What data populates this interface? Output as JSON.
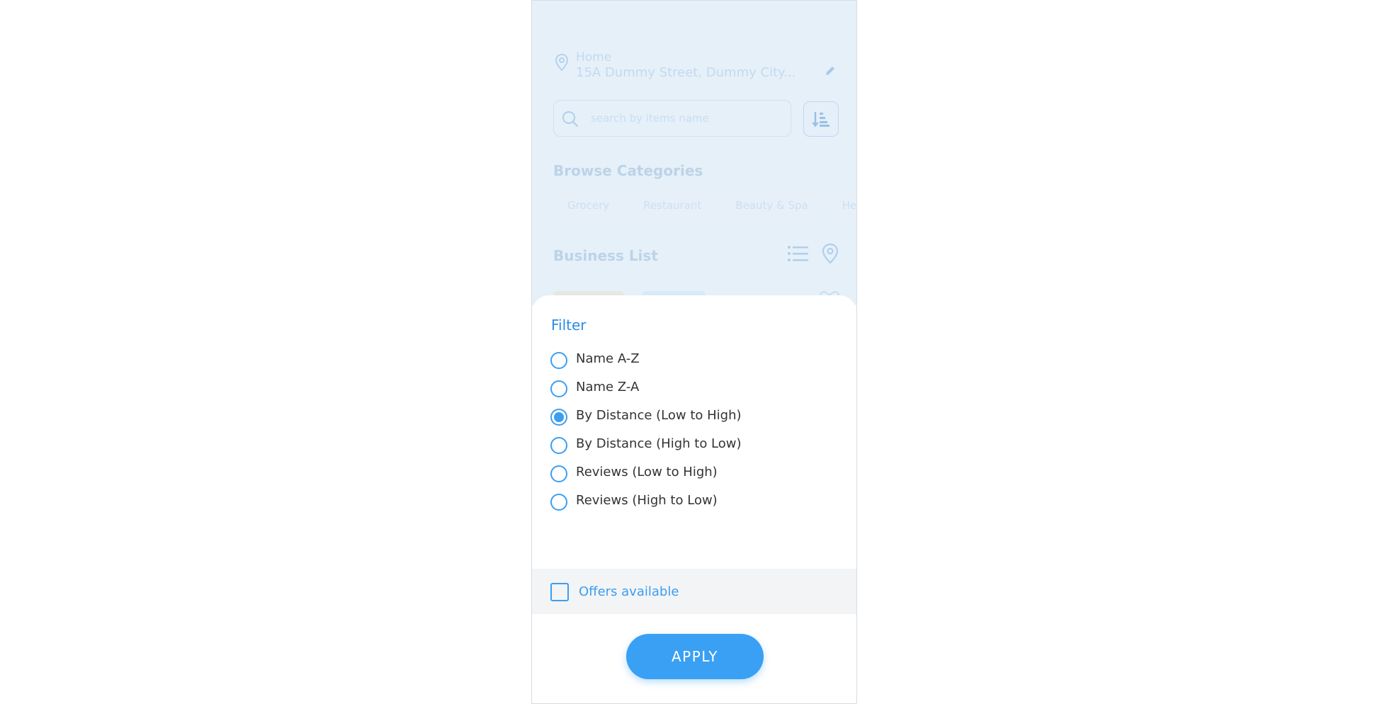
{
  "colors": {
    "accent": "#3b9ef0",
    "button": "#39a0f4",
    "backdrop": "#e6f0f9",
    "offers_row": "#f3f4f5"
  },
  "location": {
    "label": "Home",
    "address": "15A Dummy Street, Dummy City...",
    "pin_icon": "location-pin-icon",
    "edit_icon": "pencil-icon"
  },
  "search": {
    "placeholder": "search by items name",
    "value": "",
    "icon": "search-icon",
    "sort_icon": "sort-icon"
  },
  "categories": {
    "title": "Browse Categories",
    "items": [
      "Grocery",
      "Restaurant",
      "Beauty & Spa",
      "Heal"
    ]
  },
  "business_list": {
    "title": "Business List",
    "list_icon": "list-view-icon",
    "map_icon": "map-pin-icon"
  },
  "filter": {
    "title": "Filter",
    "options": [
      {
        "label": "Name A-Z",
        "checked": false
      },
      {
        "label": "Name Z-A",
        "checked": false
      },
      {
        "label": "By Distance (Low to High)",
        "checked": true
      },
      {
        "label": "By Distance (High to Low)",
        "checked": false
      },
      {
        "label": "Reviews (Low to High)",
        "checked": false
      },
      {
        "label": "Reviews (High to Low)",
        "checked": false
      }
    ],
    "offers_label": "Offers available",
    "offers_checked": false,
    "apply_label": "APPLY"
  }
}
